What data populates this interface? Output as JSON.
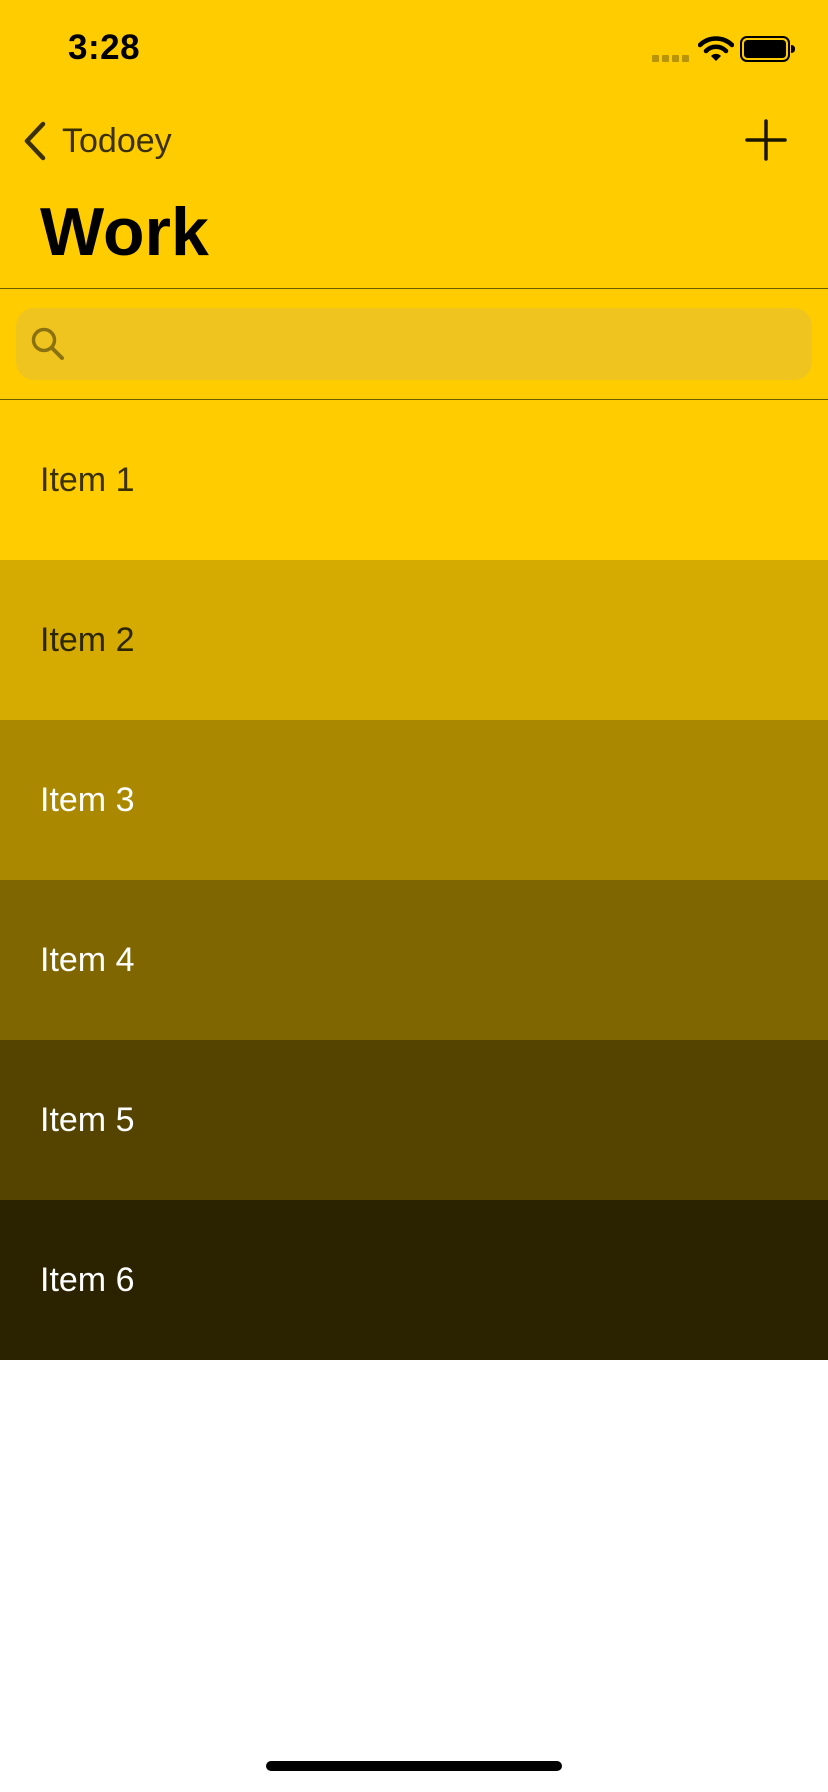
{
  "status_bar": {
    "time": "3:28",
    "icons": [
      "cellular-signal-icon",
      "wifi-icon",
      "battery-icon"
    ]
  },
  "nav": {
    "back_label": "Todoey",
    "add_icon": "plus-icon",
    "title": "Work"
  },
  "search": {
    "placeholder": "",
    "icon": "search-icon"
  },
  "items": [
    {
      "label": "Item 1",
      "bg": "#FFCC00",
      "fg": "#3a3000"
    },
    {
      "label": "Item 2",
      "bg": "#D6AB01",
      "fg": "#2d2700"
    },
    {
      "label": "Item 3",
      "bg": "#AA8800",
      "fg": "#ffffff"
    },
    {
      "label": "Item 4",
      "bg": "#806600",
      "fg": "#ffffff"
    },
    {
      "label": "Item 5",
      "bg": "#554400",
      "fg": "#ffffff"
    },
    {
      "label": "Item 6",
      "bg": "#2B2200",
      "fg": "#ffffff"
    }
  ],
  "colors": {
    "accent": "#FFCC00",
    "search_field": "#F0C41E",
    "separator": "#6e5a00"
  }
}
